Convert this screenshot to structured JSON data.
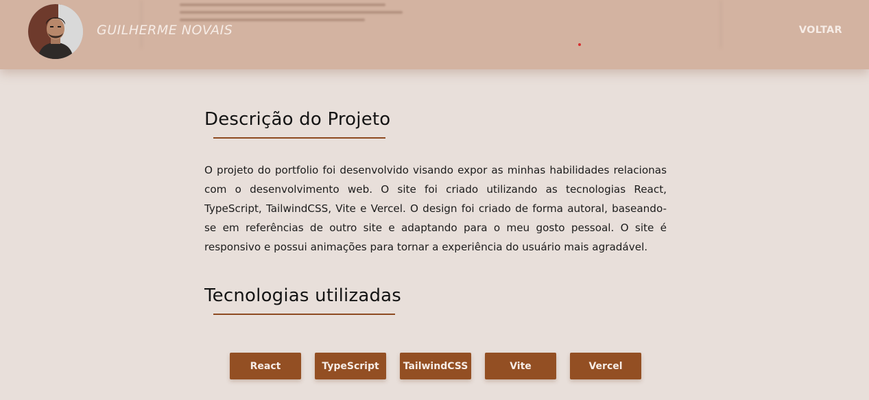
{
  "header": {
    "brand": "GUILHERME NOVAIS",
    "back_label": "VOLTAR",
    "avatar_alt": "Guilherme Novais"
  },
  "project": {
    "description_title": "Descrição do Projeto",
    "description": "O projeto do portfolio foi desenvolvido visando expor as minhas habilidades relacionas com o desenvolvimento web. O site foi criado utilizando as tecnologias React, TypeScript, TailwindCSS, Vite e Vercel. O design foi criado de forma autoral, baseando-se em referências de outro site e adaptando para o meu gosto pessoal. O site é responsivo e possui animações para tornar a experiência do usuário mais agradável.",
    "tech_title": "Tecnologias utilizadas",
    "technologies": [
      "React",
      "TypeScript",
      "TailwindCSS",
      "Vite",
      "Vercel"
    ]
  },
  "colors": {
    "header_bg": "#d3b3a1",
    "page_bg": "#e8dfda",
    "accent": "#934f23",
    "header_text": "#f6ece6"
  }
}
